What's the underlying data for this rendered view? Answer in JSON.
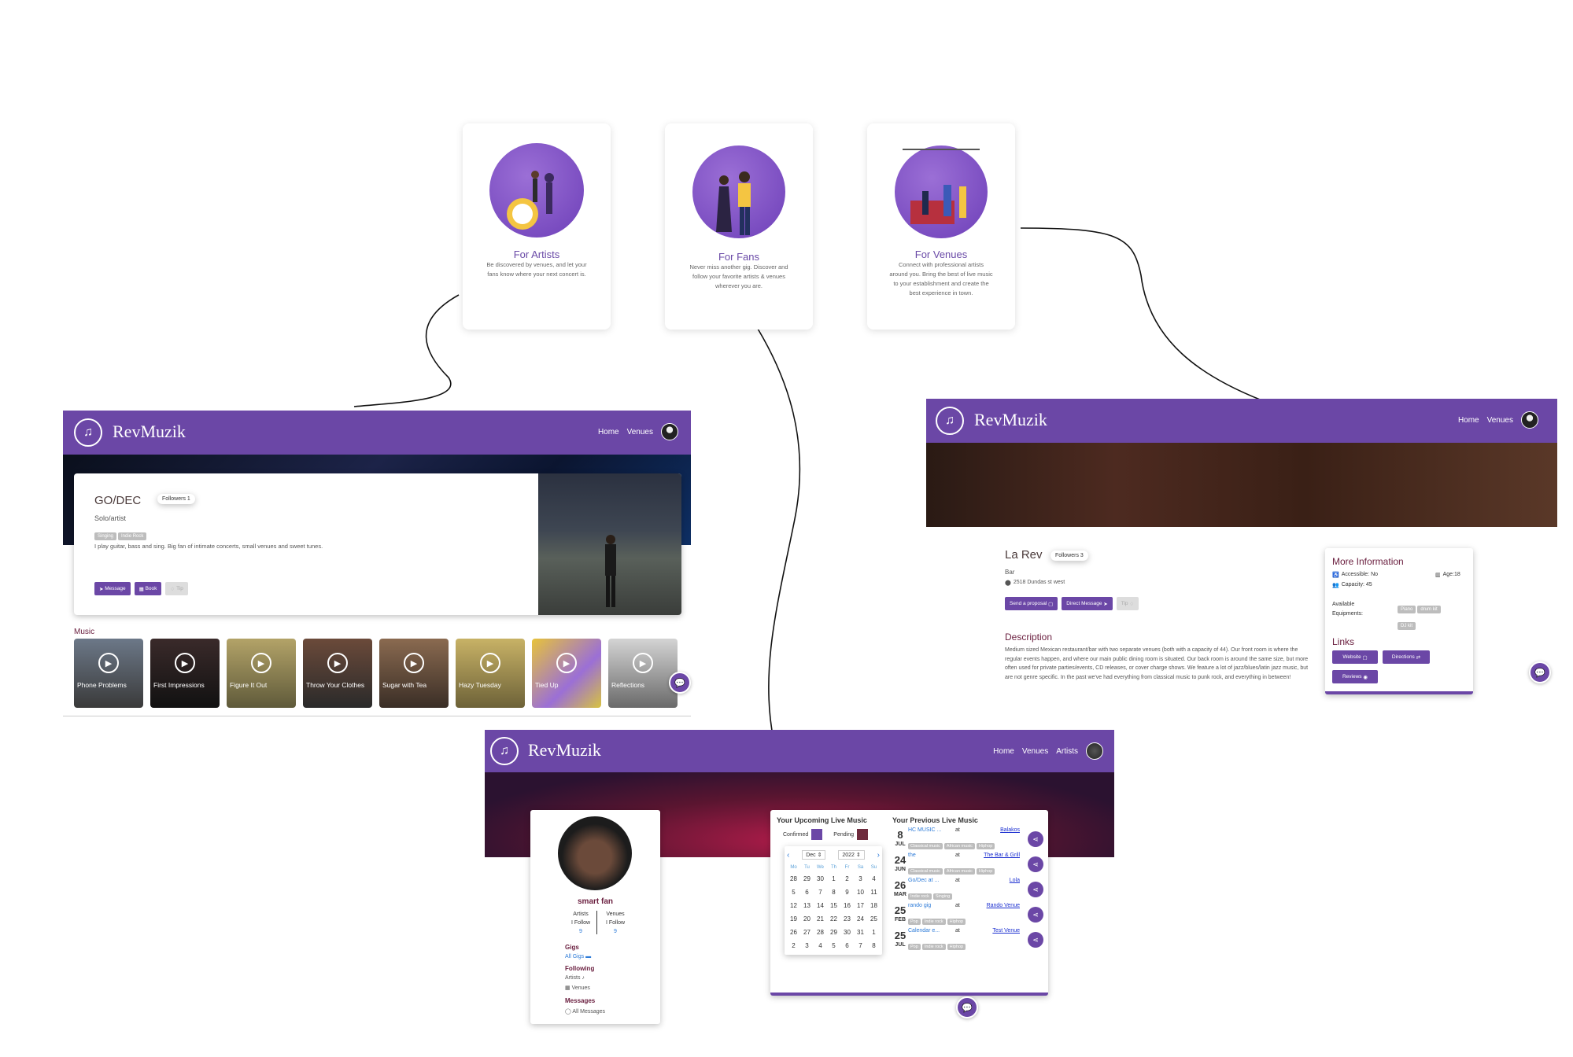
{
  "cards": [
    {
      "title": "For Artists",
      "desc": "Be discovered by venues, and let your fans know where your next concert is."
    },
    {
      "title": "For Fans",
      "desc": "Never miss another gig. Discover and follow your favorite artists & venues wherever you are."
    },
    {
      "title": "For Venues",
      "desc": "Connect with professional artists around you. Bring the best of live music to your establishment and create the best experience in town."
    }
  ],
  "brand": {
    "name": "RevMuzik"
  },
  "nav": {
    "home": "Home",
    "venues": "Venues",
    "artists": "Artists"
  },
  "artist": {
    "name": "GO/DEC",
    "followers": "Followers 1",
    "type": "Solo/artist",
    "tags": [
      "Singing",
      "Indie Rock"
    ],
    "bio": "I play guitar, bass and sing. Big fan of intimate concerts, small venues and sweet tunes.",
    "btn_message": "Message",
    "btn_book": "Book",
    "btn_tip": "Tip",
    "music_label": "Music",
    "tracks": [
      "Phone Problems",
      "First Impressions",
      "Figure It Out",
      "Throw Your Clothes",
      "Sugar with Tea",
      "Hazy Tuesday",
      "Tied Up",
      "Reflections"
    ]
  },
  "venue": {
    "name": "La Rev",
    "followers": "Followers 3",
    "type": "Bar",
    "address": "2518 Dundas st west",
    "btn_proposal": "Send a proposal",
    "btn_dm": "Direct Message",
    "btn_tip": "Tip",
    "desc_title": "Description",
    "description": "Medium sized Mexican restaurant/bar with two separate venues (both with a capacity of 44). Our front room is where the regular events happen, and where our main public dining room is situated. Our back room is around the same size, but more often used for private parties/events, CD releases, or cover charge shows. We feature a lot of jazz/blues/latin jazz music, but are not genre specific. In the past we've had everything from classical music to punk rock, and everything in between!",
    "more_info_title": "More Information",
    "accessible": "Accessible: No",
    "age": "Age:18",
    "capacity": "Capacity: 45",
    "equip_label": "Available Equipments:",
    "equip": [
      "Piano",
      "drum kit",
      "DJ kit"
    ],
    "links_title": "Links",
    "link_website": "Website",
    "link_directions": "Directions",
    "link_reviews": "Reviews"
  },
  "fan": {
    "name": "smart fan",
    "artists_label": "Artists",
    "venues_label": "Venues",
    "i_follow": "I Follow",
    "artists_count": "9",
    "venues_count": "9",
    "gigs_title": "Gigs",
    "all_gigs": "All Gigs",
    "following_title": "Following",
    "following_artists": "Artists",
    "following_venues": "Venues",
    "messages_title": "Messages",
    "all_messages": "All Messages",
    "upcoming_title": "Your Upcoming Live Music",
    "confirmed": "Confirmed",
    "pending": "Pending",
    "cal_month": "Dec",
    "cal_year": "2022",
    "weekdays": [
      "Mo",
      "Tu",
      "We",
      "Th",
      "Fr",
      "Sa",
      "Su"
    ],
    "weeks": [
      [
        "28",
        "29",
        "30",
        "1",
        "2",
        "3",
        "4"
      ],
      [
        "5",
        "6",
        "7",
        "8",
        "9",
        "10",
        "11"
      ],
      [
        "12",
        "13",
        "14",
        "15",
        "16",
        "17",
        "18"
      ],
      [
        "19",
        "20",
        "21",
        "22",
        "23",
        "24",
        "25"
      ],
      [
        "26",
        "27",
        "28",
        "29",
        "30",
        "31",
        "1"
      ],
      [
        "2",
        "3",
        "4",
        "5",
        "6",
        "7",
        "8"
      ]
    ],
    "previous_title": "Your Previous Live Music",
    "at": "at",
    "gigs": [
      {
        "day": "8",
        "month": "JUL",
        "name": "HC MUSIC ...",
        "venue": "Balakos",
        "tags": [
          "Classical music",
          "African music",
          "Hiphop"
        ]
      },
      {
        "day": "24",
        "month": "JUN",
        "name": "the",
        "venue": "The Bar & Grill",
        "tags": [
          "Classical music",
          "African music",
          "Hiphop"
        ]
      },
      {
        "day": "26",
        "month": "MAR",
        "name": "Go/Dec at ...",
        "venue": "Lola",
        "tags": [
          "Indie rock",
          "Singing"
        ]
      },
      {
        "day": "25",
        "month": "FEB",
        "name": "rando gig",
        "venue": "Rando Venue",
        "tags": [
          "Pop",
          "Indie rock",
          "Hiphop"
        ]
      },
      {
        "day": "25",
        "month": "JUL",
        "name": "Calendar e...",
        "venue": "Test Venue",
        "tags": [
          "Pop",
          "Indie rock",
          "Hiphop"
        ]
      }
    ]
  },
  "colors": {
    "brand": "#6b47a6",
    "confirmed": "#6b47a6",
    "pending": "#6e2b3d",
    "link": "#2d7bd8"
  }
}
